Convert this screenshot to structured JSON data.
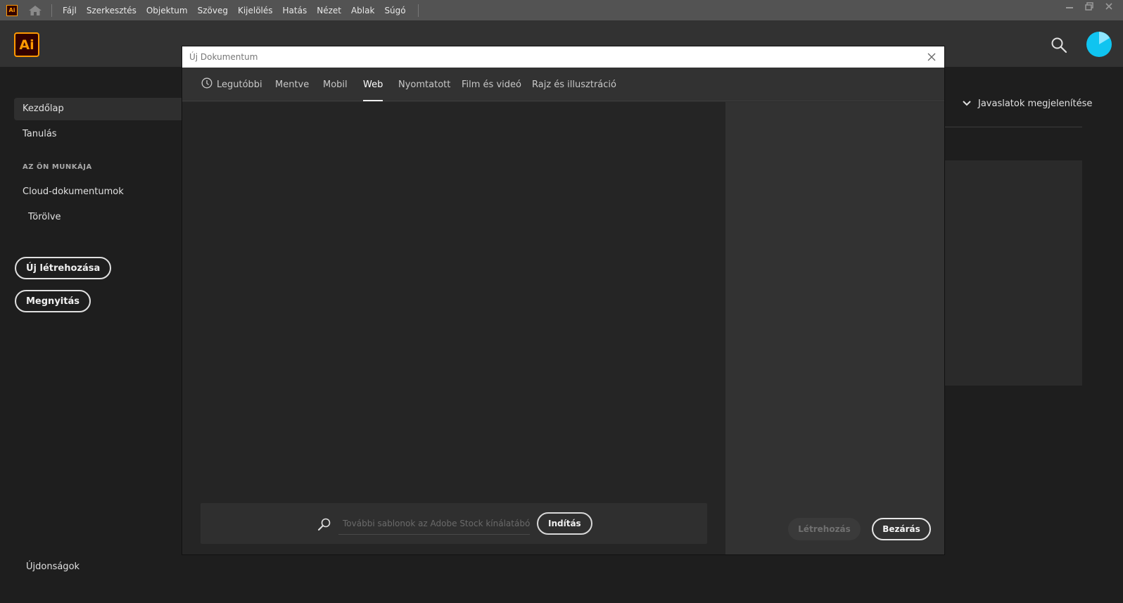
{
  "menubar": {
    "app_icon_label": "Ai",
    "home_icon": "home-icon",
    "items": [
      "Fájl",
      "Szerkesztés",
      "Objektum",
      "Szöveg",
      "Kijelölés",
      "Hatás",
      "Nézet",
      "Ablak",
      "Súgó"
    ],
    "window_controls": [
      "minimize-icon",
      "restore-icon",
      "close-icon"
    ]
  },
  "header": {
    "logo_label": "Ai",
    "search_icon": "search-icon",
    "avatar_color": "#10c4f0"
  },
  "sidebar": {
    "items": [
      "Kezdőlap",
      "Tanulás"
    ],
    "section_title": "AZ ÖN MUNKÁJA",
    "work_items": [
      "Cloud-dokumentumok",
      "Törölve"
    ],
    "new_button": "Új létrehozása",
    "open_button": "Megnyitás",
    "whats_new": "Újdonságok"
  },
  "main": {
    "suggestions_toggle": "Javaslatok megjelenítése"
  },
  "dialog": {
    "title": "Új Dokumentum",
    "tabs": [
      {
        "label": "Legutóbbi",
        "icon": "clock-icon"
      },
      {
        "label": "Mentve"
      },
      {
        "label": "Mobil"
      },
      {
        "label": "Web",
        "active": true
      },
      {
        "label": "Nyomtatott"
      },
      {
        "label": "Film és videó"
      },
      {
        "label": "Rajz és illusztráció"
      }
    ],
    "search_placeholder": "További sablonok az Adobe Stock kínálatából",
    "start_button": "Indítás",
    "create_button": "Létrehozás",
    "close_button": "Bezárás"
  },
  "colors": {
    "brand_orange": "#ff9a00",
    "brand_dark": "#330000",
    "avatar": "#10c4f0"
  }
}
